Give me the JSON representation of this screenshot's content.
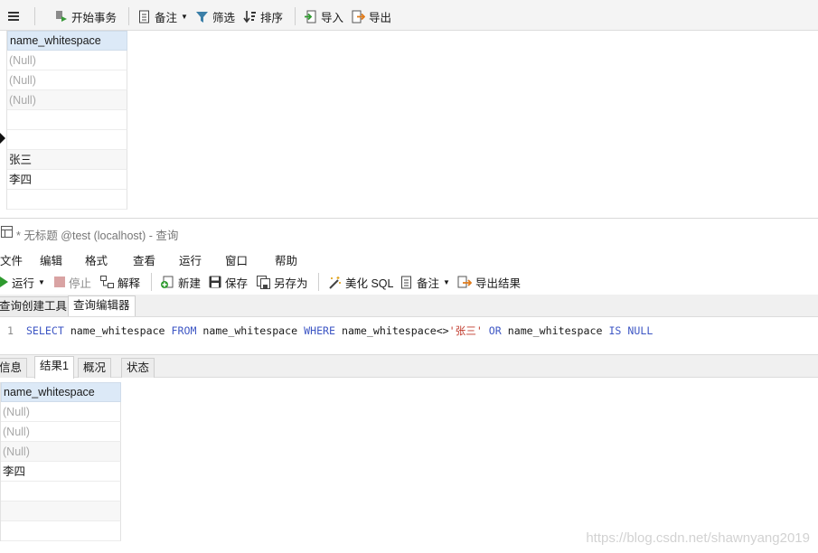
{
  "top_toolbar": {
    "begin_tx": "开始事务",
    "note": "备注",
    "filter": "筛选",
    "sort": "排序",
    "import": "导入",
    "export": "导出"
  },
  "grid_top": {
    "header": "name_whitespace",
    "rows": [
      "(Null)",
      "(Null)",
      "(Null)",
      "",
      "",
      "张三",
      "李四",
      ""
    ]
  },
  "window": {
    "title": "* 无标题 @test (localhost) - 查询"
  },
  "menu": {
    "items": [
      "文件",
      "编辑",
      "格式",
      "查看",
      "运行",
      "窗口",
      "帮助"
    ]
  },
  "query_toolbar": {
    "run": "运行",
    "stop": "停止",
    "explain": "解释",
    "new": "新建",
    "save": "保存",
    "save_as": "另存为",
    "beautify": "美化 SQL",
    "note": "备注",
    "export_result": "导出结果"
  },
  "editor_tabs": [
    "查询创建工具",
    "查询编辑器"
  ],
  "editor": {
    "line_number": "1",
    "kw_select": "SELECT",
    "col": " name_whitespace ",
    "kw_from": "FROM",
    "table": " name_whitespace ",
    "kw_where": "WHERE",
    "cond": " name_whitespace<>",
    "literal": "'张三'",
    "kw_or": "OR",
    "col2": " name_whitespace ",
    "kw_isnull": "IS NULL"
  },
  "result_tabs": [
    "信息",
    "结果1",
    "概况",
    "状态"
  ],
  "grid_result": {
    "header": "name_whitespace",
    "rows": [
      "(Null)",
      "(Null)",
      "(Null)",
      "李四",
      "",
      "",
      ""
    ]
  },
  "watermark": "https://blog.csdn.net/shawnyang2019"
}
